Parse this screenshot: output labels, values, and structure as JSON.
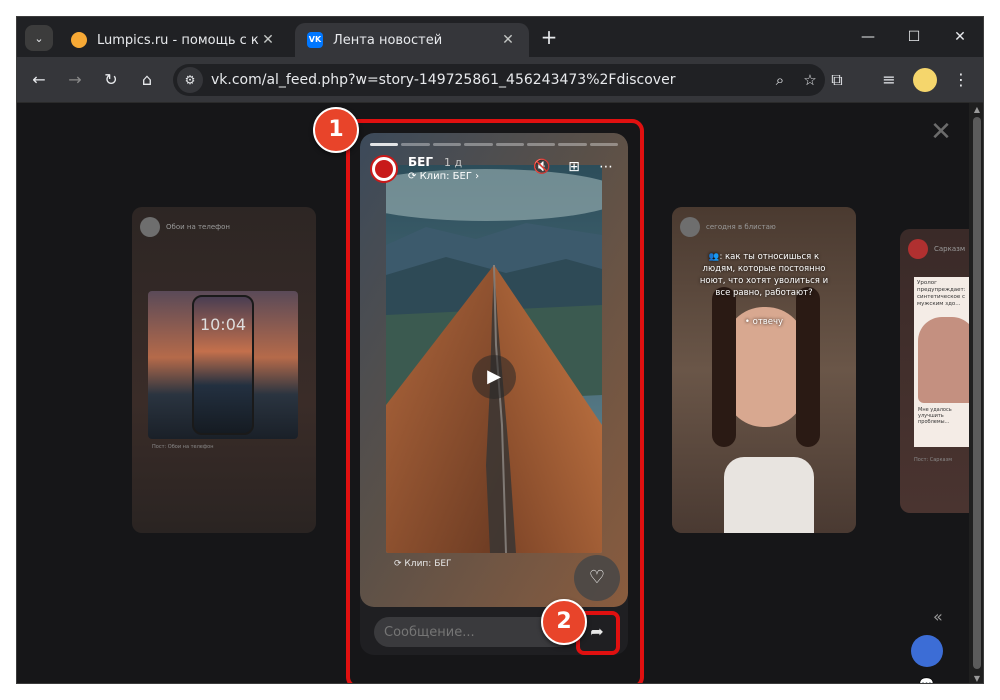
{
  "browser": {
    "tabs": [
      {
        "title": "Lumpics.ru - помощь с компьютером",
        "favicon_color": "#f7a935",
        "active": false
      },
      {
        "title": "Лента новостей",
        "favicon_color": "#0077ff",
        "favicon_text": "VK",
        "active": true
      }
    ],
    "address_bar": {
      "url": "vk.com/al_feed.php?w=story-149725861_456243473%2Fdiscover"
    },
    "icons": {
      "tab_search": "chevron-down-icon",
      "new_tab": "plus-icon",
      "minimize": "minimize-icon",
      "maximize": "maximize-icon",
      "close": "close-icon",
      "back": "back-arrow-icon",
      "forward": "forward-arrow-icon",
      "reload": "reload-icon",
      "home": "home-icon",
      "site_info": "tune-icon",
      "zoom": "magnifier-icon",
      "bookmark": "star-icon",
      "extensions": "puzzle-icon",
      "media": "media-queue-icon",
      "menu": "kebab-menu-icon"
    }
  },
  "stories": {
    "left_preview": {
      "author": "Обои на телефон",
      "phone_time": "10:04",
      "clip_label": "Пост: Обои на телефон"
    },
    "main": {
      "author": "БЕГ",
      "time": "1 д",
      "clip_label": "Клип: БЕГ",
      "bottom_clip_label": "Клип: БЕГ",
      "message_placeholder": "Сообщение...",
      "progress_segments": 8,
      "avatar_text": "БЕГ"
    },
    "right_preview": {
      "author": "сегодня в блистаю",
      "caption": "👥: как ты относишься к людям, которые постоянно ноют, что хотят уволиться и все равно, работают?",
      "subcaption": "• отвечу"
    },
    "far_right_preview": {
      "author": "Сарказм",
      "caption_top": "Уролог предупреждает: синтетическое с мужским здо...",
      "caption_bottom": "Мне удалось улучшить проблемы...",
      "clip_label": "Пост: Сарказм"
    }
  },
  "annotations": [
    {
      "number": "1",
      "target": "story-card"
    },
    {
      "number": "2",
      "target": "share-button"
    }
  ],
  "accent_colors": {
    "highlight": "#e01010",
    "badge": "#e8442a",
    "vk": "#0077ff"
  }
}
